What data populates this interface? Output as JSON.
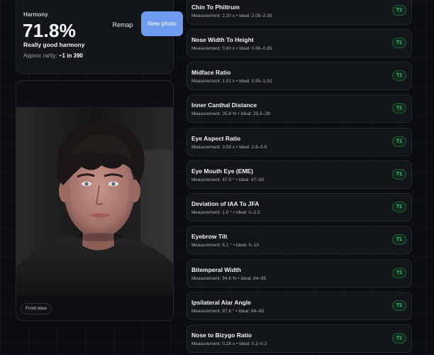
{
  "harmony": {
    "label": "Harmony",
    "score": "71.8%",
    "verdict": "Really good harmony",
    "rarity_label": "Approx rarity:",
    "rarity_value": "~1 in 390",
    "remap_label": "Remap",
    "new_photo_label": "New photo"
  },
  "photo": {
    "view_label": "Front view"
  },
  "metrics": [
    {
      "name": "Chin To Philtrum",
      "measurement": "2.20",
      "unit": "x",
      "ideal": "2.05–2.55",
      "tier": "T1"
    },
    {
      "name": "Nose Width To Height",
      "measurement": "0.80",
      "unit": "x",
      "ideal": "0.66–0.85",
      "tier": "T1"
    },
    {
      "name": "Midface Ratio",
      "measurement": "1.01",
      "unit": "x",
      "ideal": "0.95–1.02",
      "tier": "T1"
    },
    {
      "name": "Inner Canthal Distance",
      "measurement": "25.9",
      "unit": "%",
      "ideal": "25.5–28",
      "tier": "T1"
    },
    {
      "name": "Eye Aspect Ratio",
      "measurement": "3.59",
      "unit": "x",
      "ideal": "2.8–3.6",
      "tier": "T1"
    },
    {
      "name": "Eye Mouth Eye (EME)",
      "measurement": "47.9",
      "unit": "°",
      "ideal": "47–50",
      "tier": "T1"
    },
    {
      "name": "Deviation of IAA To JFA",
      "measurement": "1.0",
      "unit": "°",
      "ideal": "0–2.5",
      "tier": "T1"
    },
    {
      "name": "Eyebrow Tilt",
      "measurement": "6.1",
      "unit": "°",
      "ideal": "5–13",
      "tier": "T1"
    },
    {
      "name": "Bitemperal Width",
      "measurement": "94.6",
      "unit": "%",
      "ideal": "84–95",
      "tier": "T1"
    },
    {
      "name": "Ipsilateral Alar Angle",
      "measurement": "87.6",
      "unit": "°",
      "ideal": "84–95",
      "tier": "T1"
    },
    {
      "name": "Nose to Bizygo Ratio",
      "measurement": "0.28",
      "unit": "x",
      "ideal": "0.2–0.3",
      "tier": "T1"
    }
  ],
  "labels": {
    "measurement_prefix": "Measurement:",
    "ideal_prefix": "Ideal:"
  },
  "colors": {
    "accent_button": "#6e9bef",
    "tier_badge_text": "#36d07a",
    "tier_badge_bg": "#112a1d"
  }
}
